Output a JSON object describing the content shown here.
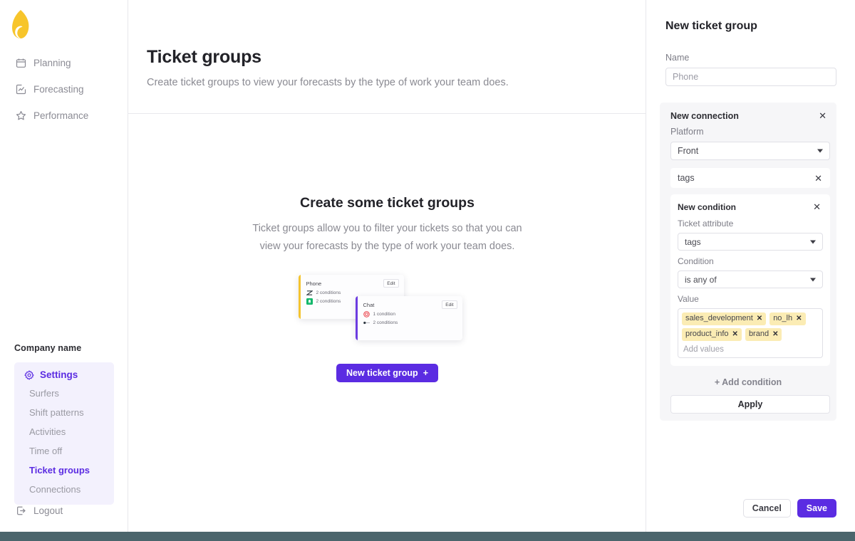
{
  "brand": {
    "logo_icon": "leaf-logo-icon",
    "logo_color": "#f7c52b",
    "accent_color": "#5b2ce2",
    "footer_color": "#4b656c"
  },
  "sidebar": {
    "nav": [
      {
        "label": "Planning",
        "icon": "calendar-icon"
      },
      {
        "label": "Forecasting",
        "icon": "forecast-chart-icon"
      },
      {
        "label": "Performance",
        "icon": "star-icon"
      }
    ],
    "company_name": "Company name",
    "settings": {
      "label": "Settings",
      "icon": "gear-icon",
      "items": [
        {
          "label": "Surfers",
          "active": false
        },
        {
          "label": "Shift patterns",
          "active": false
        },
        {
          "label": "Activities",
          "active": false
        },
        {
          "label": "Time off",
          "active": false
        },
        {
          "label": "Ticket groups",
          "active": true
        },
        {
          "label": "Connections",
          "active": false
        }
      ]
    },
    "logout": {
      "label": "Logout",
      "icon": "logout-icon"
    }
  },
  "main": {
    "title": "Ticket groups",
    "subtitle": "Create ticket groups to view your forecasts by the type of work your team does.",
    "empty": {
      "title": "Create some ticket groups",
      "description": "Ticket groups allow you to filter your tickets so that you can view your forecasts by the type of work your team does.",
      "button_label": "New ticket group",
      "button_icon": "plus-icon"
    },
    "illustration": {
      "cards": [
        {
          "name": "Phone",
          "edit_label": "Edit",
          "accent": "#f4c430",
          "rows": [
            {
              "icon": "zendesk-icon",
              "label": "2 conditions"
            },
            {
              "icon": "front-icon",
              "label": "2 conditions"
            }
          ]
        },
        {
          "name": "Chat",
          "edit_label": "Edit",
          "accent": "#6c3ce0",
          "rows": [
            {
              "icon": "intercom-icon",
              "label": "1 condition"
            },
            {
              "icon": "toggle-icon",
              "label": "2 conditions"
            }
          ]
        }
      ]
    }
  },
  "panel": {
    "title": "New ticket group",
    "name_label": "Name",
    "name_placeholder": "Phone",
    "name_value": "",
    "connection": {
      "title": "New connection",
      "close_icon": "close-icon",
      "platform_label": "Platform",
      "platform_value": "Front",
      "attribute_chip_value": "tags",
      "attribute_chip_close_icon": "close-icon",
      "condition": {
        "title": "New condition",
        "close_icon": "close-icon",
        "attribute_label": "Ticket attribute",
        "attribute_value": "tags",
        "condition_label": "Condition",
        "condition_value": "is any of",
        "value_label": "Value",
        "values": [
          "sales_development",
          "no_lh",
          "product_info",
          "brand"
        ],
        "value_placeholder": "Add values",
        "chip_close_icon": "close-icon"
      },
      "add_condition_label": "Add condition",
      "add_condition_icon": "plus-icon",
      "apply_label": "Apply"
    },
    "cancel_label": "Cancel",
    "save_label": "Save"
  }
}
